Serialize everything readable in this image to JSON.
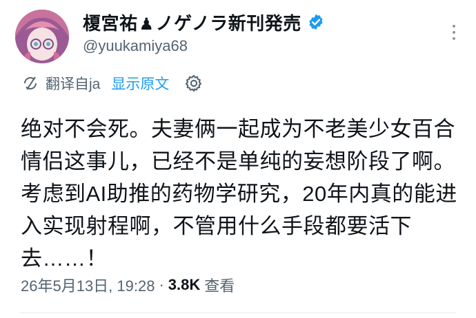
{
  "profile": {
    "display_name_part1": "榎宮祐",
    "piece_icon": "chess-pawn-icon",
    "display_name_part2": "ノゲノラ新刊発売",
    "handle": "@yuukamiya68",
    "verified_color": "#1d9bf0"
  },
  "translation": {
    "label": "翻译自ja",
    "show_original": "显示原文",
    "link_color": "#1d9bf0"
  },
  "tweet": {
    "text": "绝对不会死。夫妻俩一起成为不老美少女百合情侣这事儿，已经不是单纯的妄想阶段了啊。考虑到AI助推的药物学研究，20年内真的能进入实现射程啊，不管用什么手段都要活下去……！"
  },
  "meta": {
    "timestamp": "26年5月13日, 19:28",
    "separator": "·",
    "views_count": "3.8K",
    "views_label": "查看"
  }
}
